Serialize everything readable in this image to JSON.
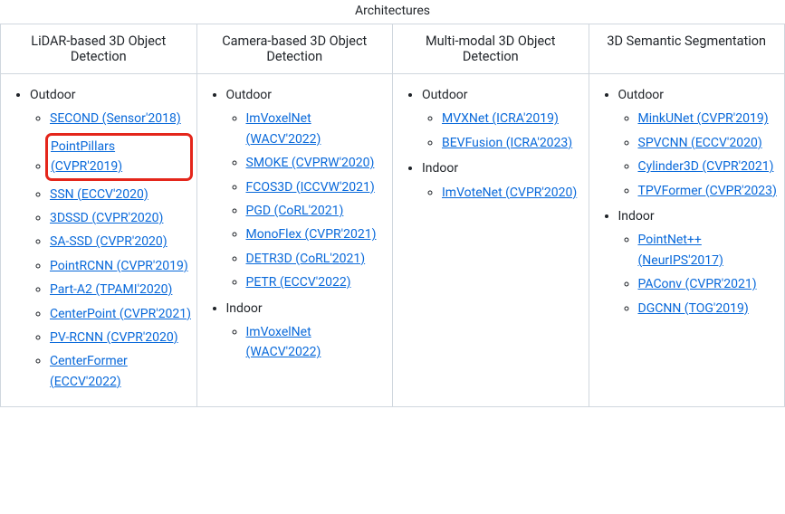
{
  "title": "Architectures",
  "columns": [
    {
      "header": "LiDAR-based 3D Object Detection",
      "sections": [
        {
          "label": "Outdoor",
          "items": [
            {
              "text": "SECOND (Sensor'2018)",
              "highlighted": false
            },
            {
              "text": "PointPillars (CVPR'2019)",
              "highlighted": true
            },
            {
              "text": "SSN (ECCV'2020)",
              "highlighted": false
            },
            {
              "text": "3DSSD (CVPR'2020)",
              "highlighted": false
            },
            {
              "text": "SA-SSD (CVPR'2020)",
              "highlighted": false
            },
            {
              "text": "PointRCNN (CVPR'2019)",
              "highlighted": false
            },
            {
              "text": "Part-A2 (TPAMI'2020)",
              "highlighted": false
            },
            {
              "text": "CenterPoint (CVPR'2021)",
              "highlighted": false
            },
            {
              "text": "PV-RCNN (CVPR'2020)",
              "highlighted": false
            },
            {
              "text": "CenterFormer (ECCV'2022)",
              "highlighted": false
            }
          ]
        }
      ]
    },
    {
      "header": "Camera-based 3D Object Detection",
      "sections": [
        {
          "label": "Outdoor",
          "items": [
            {
              "text": "ImVoxelNet (WACV'2022)",
              "highlighted": false
            },
            {
              "text": "SMOKE (CVPRW'2020)",
              "highlighted": false
            },
            {
              "text": "FCOS3D (ICCVW'2021)",
              "highlighted": false
            },
            {
              "text": "PGD (CoRL'2021)",
              "highlighted": false
            },
            {
              "text": "MonoFlex (CVPR'2021)",
              "highlighted": false
            },
            {
              "text": "DETR3D (CoRL'2021)",
              "highlighted": false
            },
            {
              "text": "PETR (ECCV'2022)",
              "highlighted": false
            }
          ]
        },
        {
          "label": "Indoor",
          "items": [
            {
              "text": "ImVoxelNet (WACV'2022)",
              "highlighted": false
            }
          ]
        }
      ]
    },
    {
      "header": "Multi-modal 3D Object Detection",
      "sections": [
        {
          "label": "Outdoor",
          "items": [
            {
              "text": "MVXNet (ICRA'2019)",
              "highlighted": false
            },
            {
              "text": "BEVFusion (ICRA'2023)",
              "highlighted": false
            }
          ]
        },
        {
          "label": "Indoor",
          "items": [
            {
              "text": "ImVoteNet (CVPR'2020)",
              "highlighted": false
            }
          ]
        }
      ]
    },
    {
      "header": "3D Semantic Segmentation",
      "sections": [
        {
          "label": "Outdoor",
          "items": [
            {
              "text": "MinkUNet (CVPR'2019)",
              "highlighted": false
            },
            {
              "text": "SPVCNN (ECCV'2020)",
              "highlighted": false
            },
            {
              "text": "Cylinder3D (CVPR'2021)",
              "highlighted": false
            },
            {
              "text": "TPVFormer (CVPR'2023)",
              "highlighted": false
            }
          ]
        },
        {
          "label": "Indoor",
          "items": [
            {
              "text": "PointNet++ (NeurIPS'2017)",
              "highlighted": false
            },
            {
              "text": "PAConv (CVPR'2021)",
              "highlighted": false
            },
            {
              "text": "DGCNN (TOG'2019)",
              "highlighted": false
            }
          ]
        }
      ]
    }
  ]
}
